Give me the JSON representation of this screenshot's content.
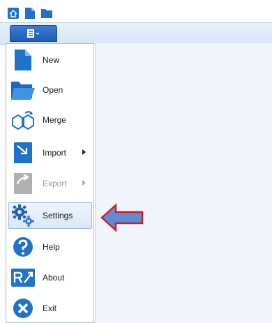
{
  "quick_access": [
    {
      "icon": "home-icon"
    },
    {
      "icon": "new-document-icon"
    },
    {
      "icon": "folder-icon"
    }
  ],
  "file_tab": {
    "icon": "application-menu-icon"
  },
  "menu": {
    "items": [
      {
        "label": "New",
        "icon": "new-document-icon"
      },
      {
        "label": "Open",
        "icon": "open-folder-icon"
      },
      {
        "label": "Merge",
        "icon": "merge-icon"
      },
      {
        "label": "Import",
        "icon": "import-icon",
        "has_submenu": true
      },
      {
        "label": "Export",
        "icon": "export-icon",
        "has_submenu": true,
        "disabled": true
      },
      {
        "label": "Settings",
        "icon": "settings-gears-icon",
        "highlighted": true
      },
      {
        "label": "Help",
        "icon": "help-icon"
      },
      {
        "label": "About",
        "icon": "about-icon"
      },
      {
        "label": "Exit",
        "icon": "exit-icon"
      }
    ]
  },
  "annotation": {
    "icon": "red-outlined-arrow-pointing-left",
    "points_to": "Settings"
  },
  "colors": {
    "accent": "#1f73c9",
    "highlight_border": "#9fb9dc",
    "arrow_fill": "#5b8ed6",
    "arrow_border": "#d9181f"
  }
}
